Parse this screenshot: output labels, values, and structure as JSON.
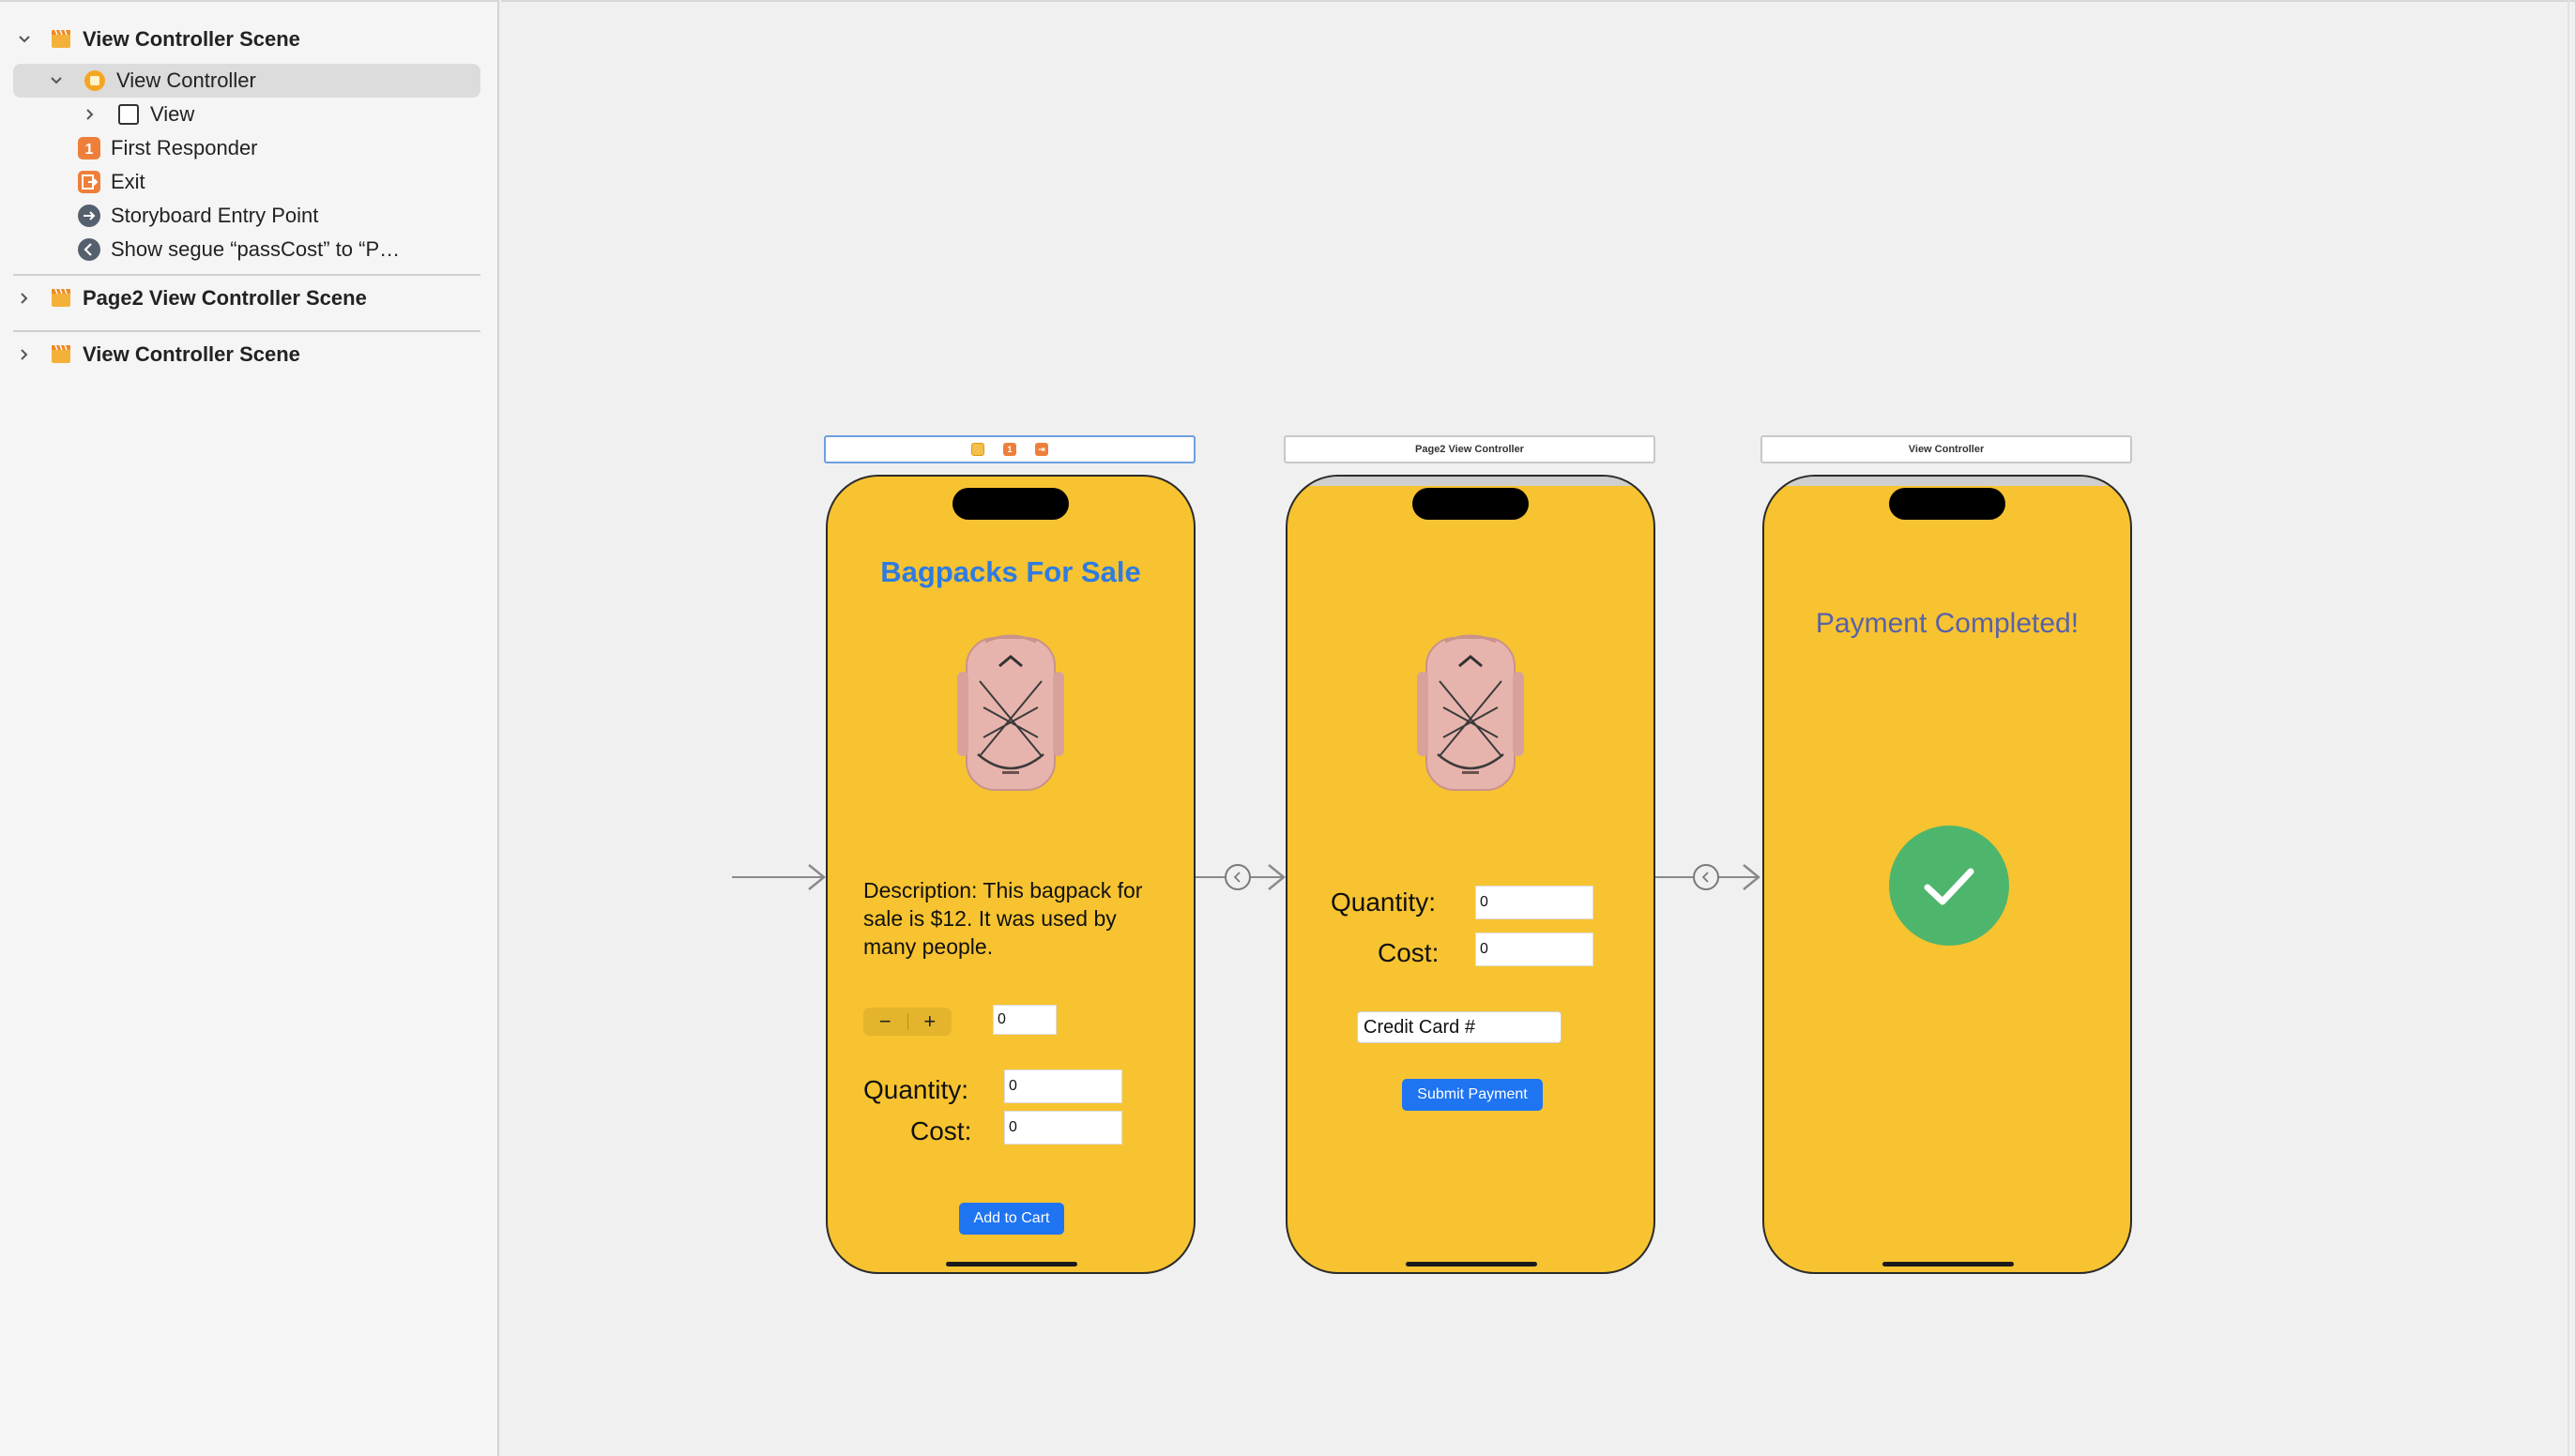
{
  "outline": {
    "scene1_title": "View Controller Scene",
    "view_controller": "View Controller",
    "view": "View",
    "first_responder": "First Responder",
    "exit": "Exit",
    "entry_point": "Storyboard Entry Point",
    "segue": "Show segue “passCost” to “P…",
    "scene2_title": "Page2 View Controller Scene",
    "scene3_title": "View Controller Scene"
  },
  "canvas": {
    "scene2_bar": "Page2 View Controller",
    "scene3_bar": "View Controller",
    "screen1": {
      "title": "Bagpacks For Sale",
      "description": "Description: This bagpack for sale is $12. It was used by many people.",
      "stepper_minus": "−",
      "stepper_plus": "+",
      "stepper_value": "0",
      "quantity_label": "Quantity:",
      "quantity_value": "0",
      "cost_label": "Cost:",
      "cost_value": "0",
      "add_to_cart": "Add to Cart"
    },
    "screen2": {
      "quantity_label": "Quantity:",
      "quantity_value": "0",
      "cost_label": "Cost:",
      "cost_value": "0",
      "credit_card": "Credit Card #",
      "submit": "Submit Payment"
    },
    "screen3": {
      "message": "Payment Completed!"
    }
  },
  "colors": {
    "phone_background": "#f7c330",
    "title_blue": "#2f7be0",
    "button_blue": "#1f74f2",
    "payment_text": "#5862a8",
    "checkmark_green": "#4eb56c",
    "scene_icon_orange": "#f0a030"
  },
  "icons": {
    "scene": "scene-icon",
    "view_controller": "view-controller-icon",
    "view": "view-icon",
    "first_responder": "first-responder-icon",
    "exit": "exit-icon",
    "entry_point": "entry-point-icon",
    "segue": "segue-icon",
    "checkmark": "checkmark-icon"
  }
}
